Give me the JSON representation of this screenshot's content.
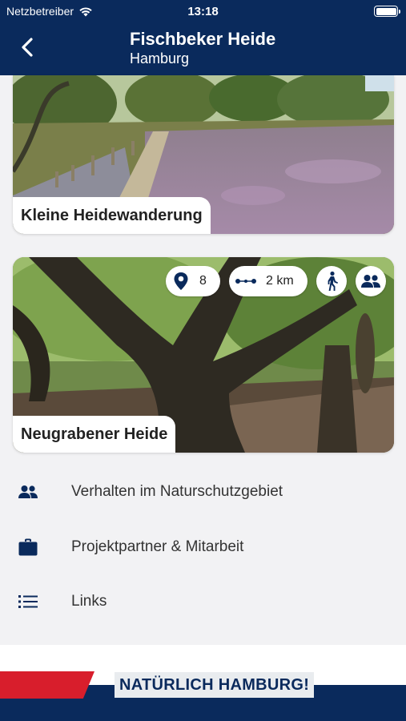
{
  "status_bar": {
    "carrier": "Netzbetreiber",
    "time": "13:18"
  },
  "header": {
    "title": "Fischbeker Heide",
    "subtitle": "Hamburg"
  },
  "cards": [
    {
      "label": "Kleine Heidewanderung"
    },
    {
      "label": "Neugrabener Heide",
      "stations": "8",
      "distance": "2 km"
    }
  ],
  "menu": [
    {
      "label": "Verhalten im Naturschutzgebiet",
      "icon": "people-icon"
    },
    {
      "label": "Projektpartner & Mitarbeit",
      "icon": "briefcase-icon"
    },
    {
      "label": "Links",
      "icon": "list-icon"
    }
  ],
  "footer": {
    "brand": "NATÜRLICH HAMBURG!"
  },
  "colors": {
    "header": "#0a2a5c",
    "accent_red": "#d81e2c",
    "background": "#f2f2f4"
  }
}
